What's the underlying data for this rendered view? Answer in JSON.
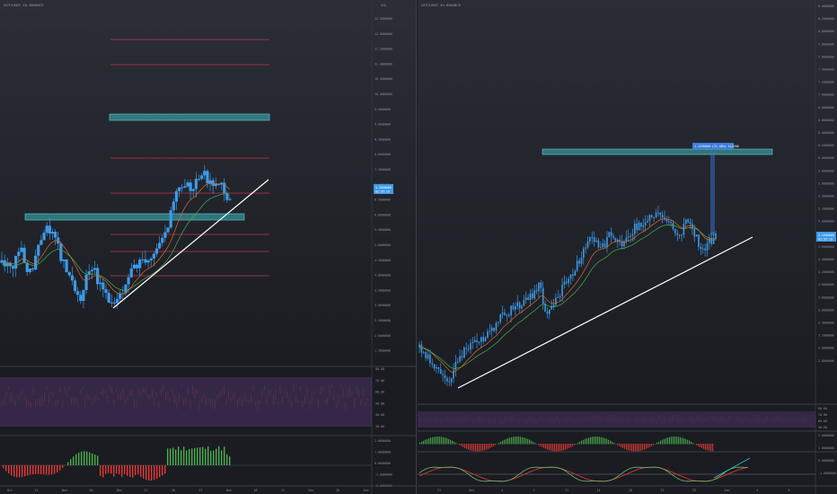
{
  "left_chart": {
    "title": "DOT/USDT, 1D, BINANCE",
    "currency": "USD",
    "price_scale": [
      "12.5000000",
      "12.0000000",
      "11.5000000",
      "11.0000000",
      "10.5000000",
      "10.0000000",
      "9.5000000",
      "9.0000000",
      "8.5000000",
      "8.0000000",
      "7.5000000",
      "7.0000000",
      "6.5000000",
      "6.0000000",
      "5.5000000",
      "5.0000000",
      "4.5000000",
      "4.0000000",
      "3.5000000",
      "3.0000000",
      "2.5000000",
      "2.0000000",
      "1.5000000"
    ],
    "last_price": "5.2850000",
    "last_price_time": "02:35:19",
    "time_labels": [
      "Oct",
      "11",
      "Nov",
      "16",
      "Dec",
      "11",
      "16",
      "21",
      "Nov",
      "16",
      "11",
      "Dec",
      "26",
      "Jan"
    ],
    "rsi_scale": [
      "80.00",
      "70.00",
      "60.00",
      "50.00",
      "40.00",
      "30.00"
    ],
    "macd_scale": [
      "2.0000000",
      "1.0000000",
      "0.0000000",
      "-1.0000000",
      "-2.0000000"
    ]
  },
  "right_chart": {
    "title": "DOT/USDT, 4h, BINANCE",
    "price_scale": [
      "8.4000000",
      "8.2000000",
      "8.0000000",
      "7.8000000",
      "7.6000000",
      "7.4000000",
      "7.2000000",
      "7.0000000",
      "6.8000000",
      "6.6000000",
      "6.4000000",
      "6.2000000",
      "6.0000000",
      "5.8000000",
      "5.6000000",
      "5.4000000",
      "5.2000000",
      "5.0000000",
      "4.8000000",
      "4.6000000",
      "4.4000000",
      "4.2000000",
      "4.0000000",
      "3.8000000",
      "3.6000000",
      "3.4000000",
      "3.2000000",
      "3.0000000",
      "2.8000000"
    ],
    "last_price": "5.1990000",
    "last_price_time": "02:35:19",
    "measure_label": "1.1220000 (21.46%) 112200",
    "time_labels": [
      "21",
      "Dec",
      "4",
      "7",
      "11",
      "14",
      "18",
      "21",
      "25",
      "Jan",
      "4",
      "8"
    ],
    "rsi_scale": [
      "80.00",
      "70.00",
      "60.00",
      "50.00"
    ],
    "macd_scale": [
      "2.0000000",
      "1.0000000",
      "0.0000000",
      "-1.0000000"
    ]
  },
  "colors": {
    "background": "#1c1e24",
    "candle": "#3d9ae8",
    "support_zone": "#3fb6c0",
    "fib_line": "#c2324c",
    "trendline": "#ffffff",
    "rsi_fill": "#6a3f8f",
    "macd_up": "#4caf50",
    "macd_down": "#e53935",
    "ema_fast": "#d86a2c",
    "ema_slow": "#4caf50"
  }
}
